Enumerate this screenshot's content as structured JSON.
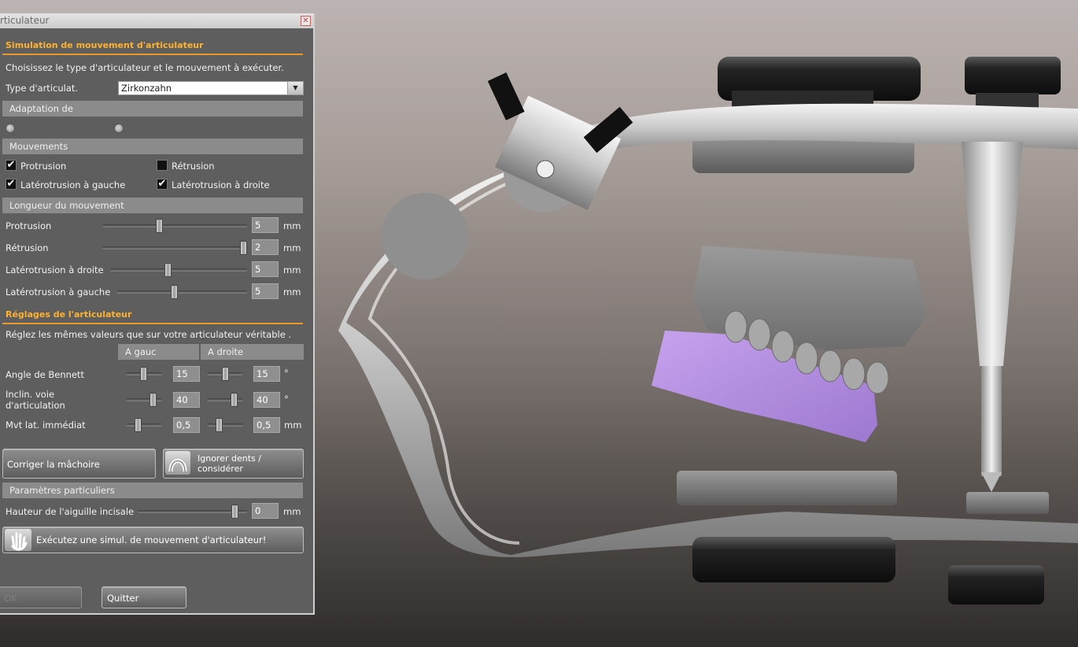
{
  "window": {
    "title": "rticulateur",
    "close_glyph": "✕"
  },
  "section1": {
    "title": "Simulation de mouvement d'articulateur",
    "instructions": "Choisissez le type d'articulateur et le mouvement à exécuter.",
    "type_label": "Type d'articulat.",
    "type_value": "Zirkonzahn",
    "arrow_glyph": "▼"
  },
  "adaptation": {
    "label": "Adaptation de"
  },
  "mouvements": {
    "label": "Mouvements",
    "items": [
      {
        "label": "Protrusion",
        "checked": true
      },
      {
        "label": "Rétrusion",
        "checked": false
      },
      {
        "label": "Latérotrusion à gauche",
        "checked": true
      },
      {
        "label": "Latérotrusion à droite",
        "checked": true
      }
    ],
    "check_glyph": "✔"
  },
  "longueur": {
    "label": "Longueur du mouvement",
    "unit": "mm",
    "rows": [
      {
        "label": "Protrusion",
        "value": "5",
        "level": 0.42
      },
      {
        "label": "Rétrusion",
        "value": "2",
        "level": 1.0
      },
      {
        "label": "Latérotrusion à droite",
        "value": "5",
        "level": 0.45
      },
      {
        "label": "Latérotrusion à gauche",
        "value": "5",
        "level": 0.47
      }
    ]
  },
  "reglages": {
    "title": "Réglages de l'articulateur",
    "instructions": "Réglez les mêmes valeurs que sur votre articulateur véritable .",
    "col_left": "A gauc",
    "col_right": "A droite",
    "rows": [
      {
        "label": "Angle de Bennett",
        "left": "15",
        "right": "15",
        "unit": "°"
      },
      {
        "label": "Inclin. voie",
        "label2": "d'articulation",
        "left": "40",
        "right": "40",
        "unit": "°"
      },
      {
        "label": "Mvt lat. immédiat",
        "left": "0,5",
        "right": "0,5",
        "unit": "mm"
      }
    ]
  },
  "buttons": {
    "correct_jaw": "Corriger la mâchoire",
    "ignore_teeth_1": "Ignorer dents /",
    "ignore_teeth_2": "considérer",
    "run_sim": "Exécutez une simul. de mouvement d'articulateur!",
    "ok": "OK",
    "quit": "Quitter"
  },
  "params": {
    "label": "Paramètres particuliers",
    "pin_height_label": "Hauteur de l'aiguille incisale",
    "pin_height_value": "0",
    "unit": "mm",
    "level": 0.92
  },
  "colors": {
    "accent": "#ffb22c",
    "panel": "#5e5e5e",
    "gum": "#b48ee0"
  }
}
